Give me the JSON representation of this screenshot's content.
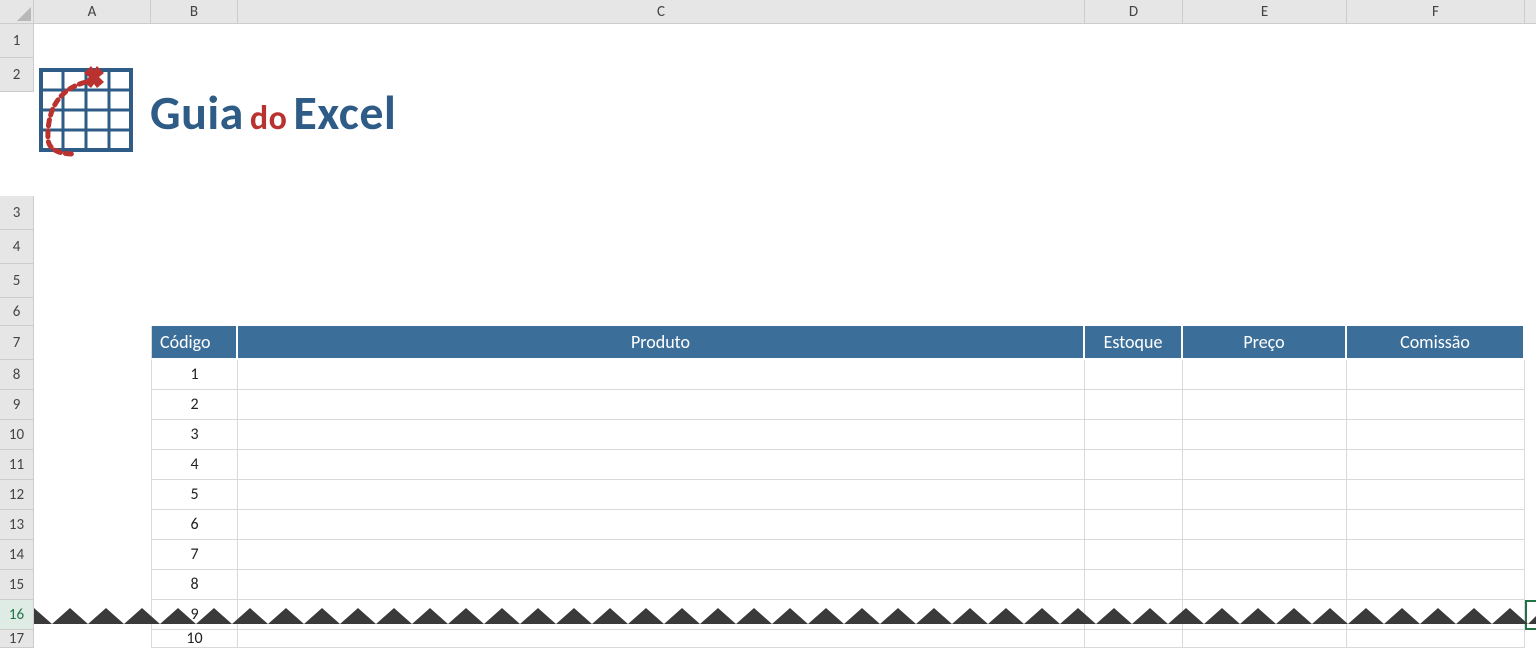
{
  "columns": [
    "A",
    "B",
    "C",
    "D",
    "E",
    "F"
  ],
  "rows": [
    "1",
    "2",
    "3",
    "4",
    "5",
    "6",
    "7",
    "8",
    "9",
    "10",
    "11",
    "12",
    "13",
    "14",
    "15",
    "16",
    "17"
  ],
  "active_row": "16",
  "logo": {
    "word1": "Guia",
    "word2": "do",
    "word3": "Excel",
    "icon_name": "guia-do-excel-logo"
  },
  "table": {
    "headers": [
      "Código",
      "Produto",
      "Estoque",
      "Preço",
      "Comissão"
    ],
    "codes": [
      "1",
      "2",
      "3",
      "4",
      "5",
      "6",
      "7",
      "8",
      "9",
      "10"
    ]
  }
}
